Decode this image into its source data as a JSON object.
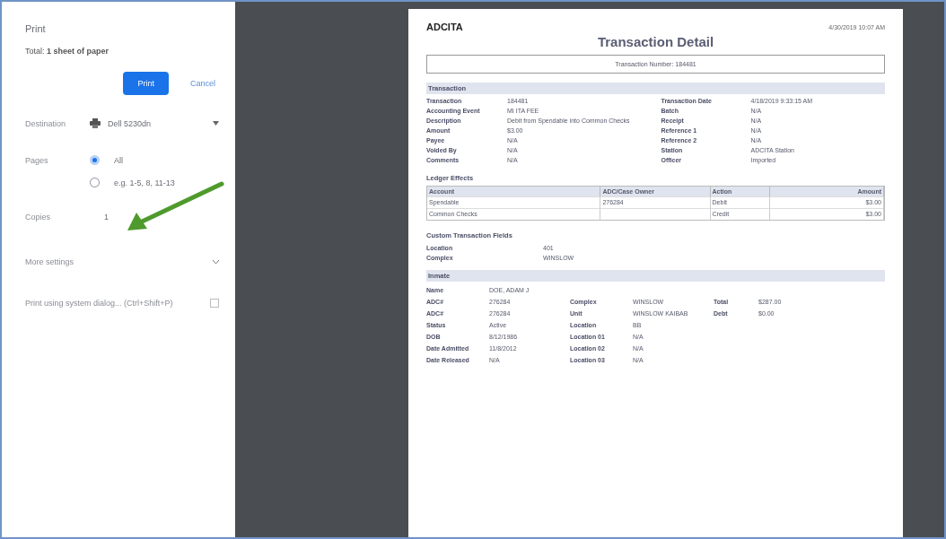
{
  "sidebar": {
    "title": "Print",
    "total": "Total: **1 sheet of paper**",
    "print_button": "Print",
    "cancel_button": "Cancel",
    "destination": {
      "label": "Destination",
      "value": "Dell 5230dn"
    },
    "pages": {
      "label": "Pages",
      "options": [
        {
          "label": "All",
          "selected": true
        },
        {
          "label": "e.g. 1-5, 8, 11-13",
          "selected": false
        }
      ]
    },
    "copies": {
      "label": "Copies",
      "value": "1"
    },
    "more_settings": {
      "label": "More settings",
      "expanded": false
    },
    "system_dialog": {
      "label": "Print using system dialog... (Ctrl+Shift+P)",
      "checked": false
    }
  },
  "document": {
    "org": "ADCITA",
    "timestamp": "4/30/2019 10:07 AM",
    "title": "Transaction Detail",
    "number": "Transaction Number: 184481",
    "transaction": {
      "heading": "Transaction",
      "left": [
        {
          "label": "Transaction",
          "value": "184481"
        },
        {
          "label": "Accounting Event",
          "value": "MI ITA FEE"
        },
        {
          "label": "Description",
          "value": "Debit from Spendable into Common Checks"
        },
        {
          "label": "Amount",
          "value": "$3.00"
        },
        {
          "label": "Payee",
          "value": "N/A"
        },
        {
          "label": "Voided By",
          "value": "N/A"
        },
        {
          "label": "Comments",
          "value": "N/A"
        }
      ],
      "right": [
        {
          "label": "Transaction Date",
          "value": "4/18/2019 9:33:15 AM"
        },
        {
          "label": "Batch",
          "value": "N/A"
        },
        {
          "label": "Receipt",
          "value": "N/A"
        },
        {
          "label": "Reference 1",
          "value": "N/A"
        },
        {
          "label": "Reference 2",
          "value": "N/A"
        },
        {
          "label": "Station",
          "value": "ADCITA Station"
        },
        {
          "label": "Officer",
          "value": "Imported"
        }
      ]
    },
    "ledger": {
      "heading": "Ledger Effects",
      "columns": [
        "Account",
        "ADC/Case Owner",
        "Action",
        "Amount"
      ],
      "rows": [
        [
          "Spendable",
          "276284",
          "Debit",
          "$3.00"
        ],
        [
          "Common Checks",
          "",
          "Credit",
          "$3.00"
        ]
      ]
    },
    "custom": {
      "heading": "Custom Transaction Fields",
      "fields": [
        {
          "label": "Location",
          "value": "401"
        },
        {
          "label": "Complex",
          "value": "WINSLOW"
        }
      ]
    },
    "inmate": {
      "heading": "Inmate",
      "name": {
        "label": "Name",
        "value": "DOE, ADAM J"
      },
      "rows": [
        [
          {
            "label": "ADC#",
            "value": "276284"
          },
          {
            "label": "Complex",
            "value": "WINSLOW"
          },
          {
            "label": "Total",
            "value": "$287.00"
          }
        ],
        [
          {
            "label": "ADC#",
            "value": "276284"
          },
          {
            "label": "Unit",
            "value": "WINSLOW KAIBAB"
          },
          {
            "label": "Debt",
            "value": "$0.00"
          }
        ],
        [
          {
            "label": "Status",
            "value": "Active"
          },
          {
            "label": "Location",
            "value": "BB"
          }
        ],
        [
          {
            "label": "DOB",
            "value": "8/12/1986"
          },
          {
            "label": "Location 01",
            "value": "N/A"
          }
        ],
        [
          {
            "label": "Date Admitted",
            "value": "11/8/2012"
          },
          {
            "label": "Location 02",
            "value": "N/A"
          }
        ],
        [
          {
            "label": "Date Released",
            "value": "N/A"
          },
          {
            "label": "Location 03",
            "value": "N/A"
          }
        ]
      ]
    }
  }
}
